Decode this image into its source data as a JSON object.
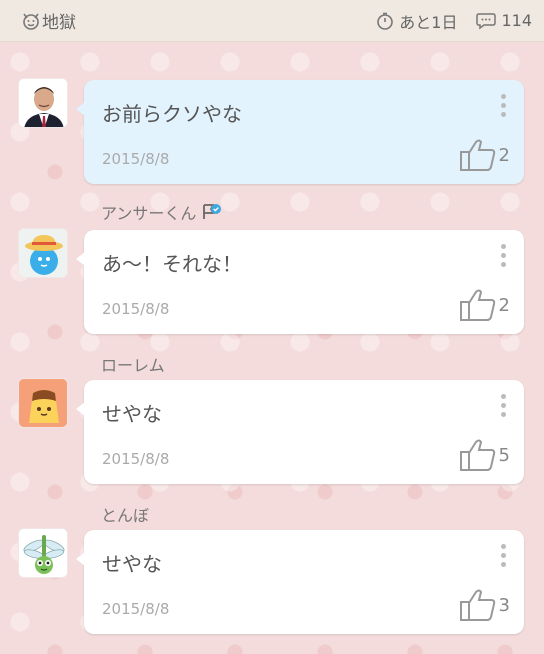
{
  "header": {
    "category": "地獄",
    "time_left": "あと1日",
    "comment_count": "114"
  },
  "posts": [
    {
      "author": "",
      "message": "お前らクソやな",
      "date": "2015/8/8",
      "likes": "2",
      "highlighted": true,
      "avatar_icon": "man-photo-icon"
    },
    {
      "author": "アンサーくん",
      "message": "あ～！それな！",
      "date": "2015/8/8",
      "likes": "2",
      "verified": true,
      "avatar_icon": "straw-hat-mascot-icon"
    },
    {
      "author": "ローレム",
      "message": "せやな",
      "date": "2015/8/8",
      "likes": "5",
      "avatar_icon": "pudding-face-icon"
    },
    {
      "author": "とんぼ",
      "message": "せやな",
      "date": "2015/8/8",
      "likes": "3",
      "avatar_icon": "dragonfly-icon"
    }
  ],
  "colors": {
    "highlight_card": "#e2f3fd",
    "background": "#f4dcdc",
    "topbar": "#efe9e1"
  }
}
